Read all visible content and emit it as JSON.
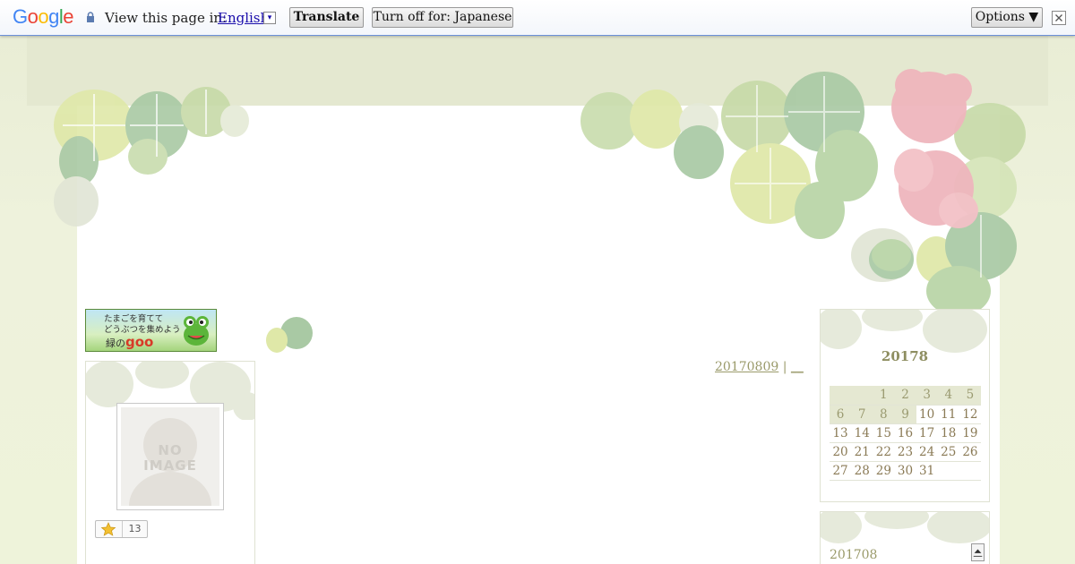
{
  "translate_bar": {
    "logo_text": "Google",
    "label": "View this page in:",
    "language": "English",
    "translate_button": "Translate",
    "turn_off_button": "Turn off for: Japanese",
    "options_button": "Options ▼",
    "dropdown_glyph": "▾",
    "close_glyph": "✕"
  },
  "banner": {
    "line1": "たまごを育てて",
    "line2": "どうぶつを集めよう",
    "prefix": "緑の",
    "brand": "goo"
  },
  "profile": {
    "placeholder_line1": "NO",
    "placeholder_line2": "IMAGE",
    "star_count": "13"
  },
  "entry": {
    "date_link": "20170809",
    "separator": " | ",
    "category_link": "__"
  },
  "calendar": {
    "title": "20178",
    "rows": [
      [
        "",
        "",
        "1",
        "2",
        "3",
        "4",
        "5"
      ],
      [
        "6",
        "7",
        "8",
        "9",
        "10",
        "11",
        "12"
      ],
      [
        "13",
        "14",
        "15",
        "16",
        "17",
        "18",
        "19"
      ],
      [
        "20",
        "21",
        "22",
        "23",
        "24",
        "25",
        "26"
      ],
      [
        "27",
        "28",
        "29",
        "30",
        "31",
        "",
        ""
      ]
    ],
    "highlighted_days": [
      "1",
      "2",
      "3",
      "4",
      "5",
      "6",
      "7",
      "8",
      "9"
    ]
  },
  "archive": {
    "title": "201708"
  },
  "colors": {
    "page_bg": "#eef2dc",
    "accent_text": "#9a9a6a",
    "leaf_green": "#a9c9a4",
    "leaf_light": "#d8e6a8",
    "hibiscus": "#efb6bd"
  }
}
